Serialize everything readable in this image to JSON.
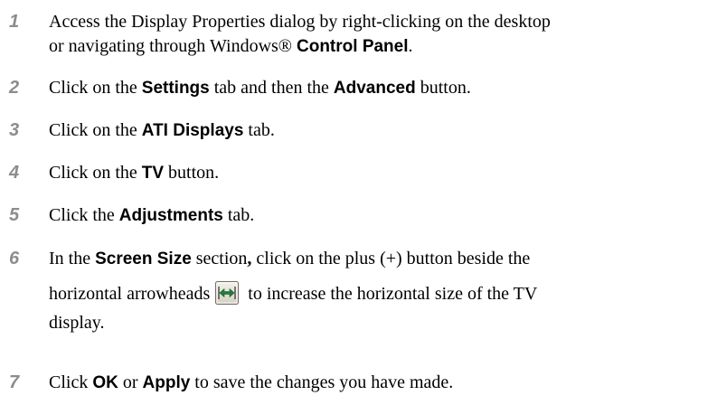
{
  "steps": [
    {
      "number": "1",
      "line1_a": "Access the Display Properties dialog by right-clicking on the desktop",
      "line2_a": "or navigating through Windows® ",
      "line2_b": "Control Panel",
      "line2_c": "."
    },
    {
      "number": "2",
      "a": "Click on the ",
      "b": "Settings",
      "c": " tab and then the ",
      "d": "Advanced",
      "e": " button."
    },
    {
      "number": "3",
      "a": "Click on the ",
      "b": "ATI Displays",
      "c": " tab."
    },
    {
      "number": "4",
      "a": "Click on the ",
      "b": "TV",
      "c": " button."
    },
    {
      "number": "5",
      "a": "Click the ",
      "b": "Adjustments",
      "c": " tab."
    },
    {
      "number": "6",
      "line1_a": "In the ",
      "line1_b": "Screen Size",
      "line1_c": " section",
      "line1_d": ",",
      "line1_e": " click on the plus (+) button beside the",
      "line2_a": "horizontal arrowheads",
      "line2_b": "to increase the horizontal size of the TV",
      "line3_a": "display.",
      "icon": "horizontal-arrowheads-icon"
    },
    {
      "number": "7",
      "a": "Click ",
      "b": "OK",
      "c": " or ",
      "d": "Apply",
      "e": " to save the changes you have made."
    }
  ]
}
